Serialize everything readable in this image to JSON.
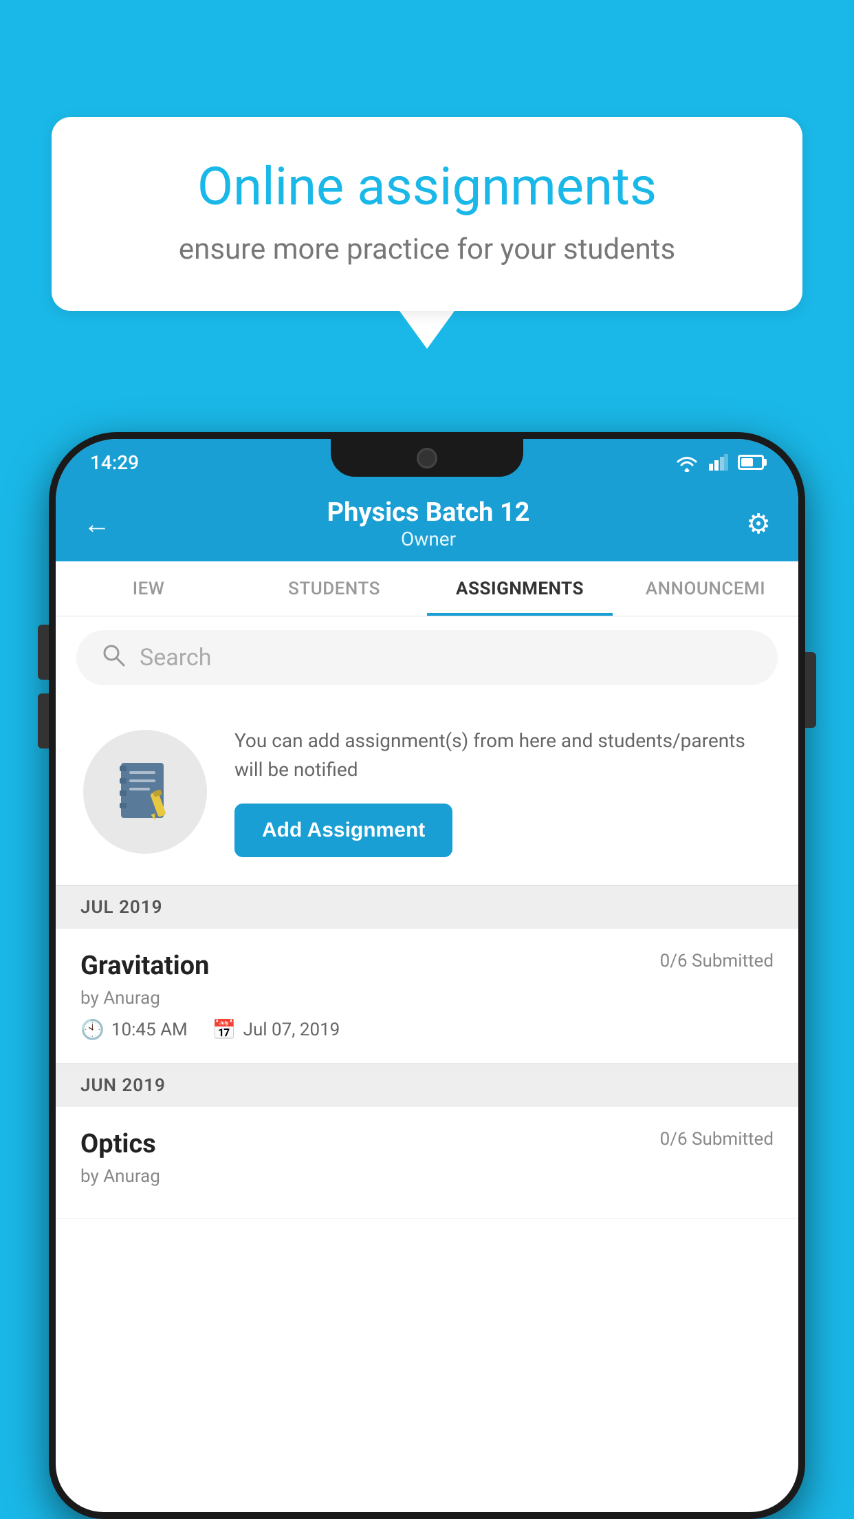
{
  "background_color": "#1ab8e8",
  "speech_bubble": {
    "title": "Online assignments",
    "subtitle": "ensure more practice for your students"
  },
  "status_bar": {
    "time": "14:29"
  },
  "app_header": {
    "title": "Physics Batch 12",
    "subtitle": "Owner",
    "back_label": "←",
    "settings_label": "⚙"
  },
  "tabs": [
    {
      "label": "IEW",
      "active": false
    },
    {
      "label": "STUDENTS",
      "active": false
    },
    {
      "label": "ASSIGNMENTS",
      "active": true
    },
    {
      "label": "ANNOUNCEMI",
      "active": false
    }
  ],
  "search": {
    "placeholder": "Search"
  },
  "promo": {
    "description": "You can add assignment(s) from here and students/parents will be notified",
    "button_label": "Add Assignment"
  },
  "sections": [
    {
      "month": "JUL 2019",
      "assignments": [
        {
          "name": "Gravitation",
          "submitted": "0/6 Submitted",
          "by": "by Anurag",
          "time": "10:45 AM",
          "date": "Jul 07, 2019"
        }
      ]
    },
    {
      "month": "JUN 2019",
      "assignments": [
        {
          "name": "Optics",
          "submitted": "0/6 Submitted",
          "by": "by Anurag",
          "time": "",
          "date": ""
        }
      ]
    }
  ]
}
